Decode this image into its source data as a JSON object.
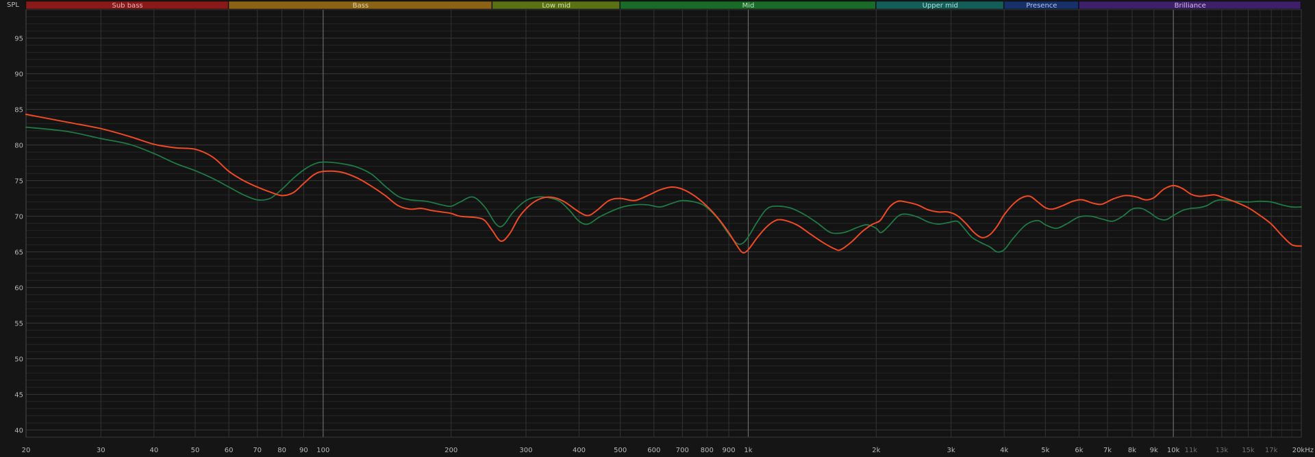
{
  "chart_data": {
    "type": "line",
    "y_axis_label": "SPL",
    "x_scale": "log",
    "y_scale": "linear",
    "xlim": [
      20,
      20000
    ],
    "ylim": [
      39,
      99
    ],
    "y_ticks": [
      {
        "value": 40,
        "label": "40"
      },
      {
        "value": 45,
        "label": "45"
      },
      {
        "value": 50,
        "label": "50"
      },
      {
        "value": 55,
        "label": "55"
      },
      {
        "value": 60,
        "label": "60"
      },
      {
        "value": 65,
        "label": "65"
      },
      {
        "value": 70,
        "label": "70"
      },
      {
        "value": 75,
        "label": "75"
      },
      {
        "value": 80,
        "label": "80"
      },
      {
        "value": 85,
        "label": "85"
      },
      {
        "value": 90,
        "label": "90"
      },
      {
        "value": 95,
        "label": "95"
      }
    ],
    "x_ticks": [
      {
        "value": 20,
        "label": "20",
        "major": true
      },
      {
        "value": 30,
        "label": "30"
      },
      {
        "value": 40,
        "label": "40"
      },
      {
        "value": 50,
        "label": "50"
      },
      {
        "value": 60,
        "label": "60"
      },
      {
        "value": 70,
        "label": "70"
      },
      {
        "value": 80,
        "label": "80"
      },
      {
        "value": 90,
        "label": "90"
      },
      {
        "value": 100,
        "label": "100",
        "major": true
      },
      {
        "value": 200,
        "label": "200"
      },
      {
        "value": 300,
        "label": "300"
      },
      {
        "value": 400,
        "label": "400"
      },
      {
        "value": 500,
        "label": "500"
      },
      {
        "value": 600,
        "label": "600"
      },
      {
        "value": 700,
        "label": "700"
      },
      {
        "value": 800,
        "label": "800"
      },
      {
        "value": 900,
        "label": "900"
      },
      {
        "value": 1000,
        "label": "1k",
        "major": true
      },
      {
        "value": 2000,
        "label": "2k"
      },
      {
        "value": 3000,
        "label": "3k"
      },
      {
        "value": 4000,
        "label": "4k"
      },
      {
        "value": 5000,
        "label": "5k"
      },
      {
        "value": 6000,
        "label": "6k"
      },
      {
        "value": 7000,
        "label": "7k"
      },
      {
        "value": 8000,
        "label": "8k"
      },
      {
        "value": 9000,
        "label": "9k"
      },
      {
        "value": 10000,
        "label": "10k",
        "major": true
      },
      {
        "value": 11000,
        "label": "11k",
        "dim": true
      },
      {
        "value": 13000,
        "label": "13k",
        "dim": true
      },
      {
        "value": 15000,
        "label": "15k",
        "dim": true
      },
      {
        "value": 17000,
        "label": "17k",
        "dim": true
      },
      {
        "value": 20000,
        "label": "20kHz"
      }
    ],
    "bands": [
      {
        "name": "Sub bass",
        "from": 20,
        "to": 60,
        "fill": "#8a1a1a",
        "text": "#e8b4b4"
      },
      {
        "name": "Bass",
        "from": 60,
        "to": 250,
        "fill": "#8a6414",
        "text": "#e6d2a6"
      },
      {
        "name": "Low mid",
        "from": 250,
        "to": 500,
        "fill": "#5a7214",
        "text": "#d2e2a6"
      },
      {
        "name": "Mid",
        "from": 500,
        "to": 2000,
        "fill": "#1a6a28",
        "text": "#b8e2bc"
      },
      {
        "name": "Upper mid",
        "from": 2000,
        "to": 4000,
        "fill": "#145e5a",
        "text": "#aee0dc"
      },
      {
        "name": "Presence",
        "from": 4000,
        "to": 6000,
        "fill": "#16306a",
        "text": "#b4c4ea"
      },
      {
        "name": "Brilliance",
        "from": 6000,
        "to": 20000,
        "fill": "#3e1f6a",
        "text": "#d2bcea"
      }
    ],
    "series": [
      {
        "color": "#1f7a45",
        "points": [
          [
            20,
            82.5
          ],
          [
            25,
            81.9
          ],
          [
            30,
            80.9
          ],
          [
            35,
            80.1
          ],
          [
            40,
            78.8
          ],
          [
            45,
            77.4
          ],
          [
            50,
            76.4
          ],
          [
            55,
            75.3
          ],
          [
            60,
            74.1
          ],
          [
            65,
            73.0
          ],
          [
            70,
            72.3
          ],
          [
            75,
            72.5
          ],
          [
            80,
            73.8
          ],
          [
            85,
            75.3
          ],
          [
            90,
            76.5
          ],
          [
            95,
            77.3
          ],
          [
            100,
            77.6
          ],
          [
            110,
            77.4
          ],
          [
            120,
            76.9
          ],
          [
            130,
            75.9
          ],
          [
            140,
            74.2
          ],
          [
            150,
            72.8
          ],
          [
            160,
            72.3
          ],
          [
            175,
            72.1
          ],
          [
            190,
            71.6
          ],
          [
            200,
            71.4
          ],
          [
            210,
            72.0
          ],
          [
            225,
            72.7
          ],
          [
            240,
            71.3
          ],
          [
            255,
            68.9
          ],
          [
            265,
            68.7
          ],
          [
            280,
            70.6
          ],
          [
            300,
            72.2
          ],
          [
            320,
            72.7
          ],
          [
            340,
            72.6
          ],
          [
            360,
            72.1
          ],
          [
            380,
            70.8
          ],
          [
            400,
            69.3
          ],
          [
            420,
            68.9
          ],
          [
            450,
            70.0
          ],
          [
            500,
            71.2
          ],
          [
            540,
            71.6
          ],
          [
            580,
            71.6
          ],
          [
            620,
            71.3
          ],
          [
            660,
            71.8
          ],
          [
            700,
            72.2
          ],
          [
            760,
            71.9
          ],
          [
            800,
            71.2
          ],
          [
            850,
            69.6
          ],
          [
            900,
            67.5
          ],
          [
            940,
            66.2
          ],
          [
            970,
            66.2
          ],
          [
            1000,
            67.1
          ],
          [
            1050,
            69.2
          ],
          [
            1100,
            70.9
          ],
          [
            1150,
            71.4
          ],
          [
            1250,
            71.2
          ],
          [
            1350,
            70.3
          ],
          [
            1450,
            69.1
          ],
          [
            1550,
            67.8
          ],
          [
            1620,
            67.6
          ],
          [
            1700,
            67.8
          ],
          [
            1800,
            68.4
          ],
          [
            1900,
            68.8
          ],
          [
            2000,
            68.3
          ],
          [
            2050,
            67.7
          ],
          [
            2130,
            68.5
          ],
          [
            2250,
            70.0
          ],
          [
            2350,
            70.3
          ],
          [
            2500,
            69.9
          ],
          [
            2650,
            69.2
          ],
          [
            2800,
            68.9
          ],
          [
            2950,
            69.1
          ],
          [
            3100,
            69.3
          ],
          [
            3200,
            68.5
          ],
          [
            3350,
            67.1
          ],
          [
            3500,
            66.4
          ],
          [
            3700,
            65.7
          ],
          [
            3850,
            65.0
          ],
          [
            4000,
            65.3
          ],
          [
            4200,
            66.9
          ],
          [
            4500,
            68.8
          ],
          [
            4800,
            69.4
          ],
          [
            5000,
            68.8
          ],
          [
            5300,
            68.3
          ],
          [
            5600,
            68.9
          ],
          [
            6000,
            69.9
          ],
          [
            6400,
            70.0
          ],
          [
            6800,
            69.6
          ],
          [
            7200,
            69.3
          ],
          [
            7600,
            70.0
          ],
          [
            8000,
            71.0
          ],
          [
            8400,
            71.1
          ],
          [
            8800,
            70.5
          ],
          [
            9200,
            69.7
          ],
          [
            9600,
            69.5
          ],
          [
            10000,
            70.1
          ],
          [
            10500,
            70.8
          ],
          [
            11000,
            71.1
          ],
          [
            11500,
            71.2
          ],
          [
            12000,
            71.5
          ],
          [
            12500,
            72.1
          ],
          [
            13000,
            72.3
          ],
          [
            14000,
            72.1
          ],
          [
            15000,
            72.0
          ],
          [
            16000,
            72.1
          ],
          [
            17000,
            72.0
          ],
          [
            18000,
            71.6
          ],
          [
            19000,
            71.3
          ],
          [
            20000,
            71.3
          ]
        ]
      },
      {
        "color": "#f04a24",
        "points": [
          [
            20,
            84.3
          ],
          [
            25,
            83.2
          ],
          [
            30,
            82.3
          ],
          [
            35,
            81.2
          ],
          [
            40,
            80.1
          ],
          [
            45,
            79.6
          ],
          [
            50,
            79.4
          ],
          [
            55,
            78.3
          ],
          [
            60,
            76.3
          ],
          [
            65,
            75.0
          ],
          [
            70,
            74.1
          ],
          [
            75,
            73.4
          ],
          [
            80,
            72.9
          ],
          [
            85,
            73.3
          ],
          [
            90,
            74.6
          ],
          [
            95,
            75.8
          ],
          [
            100,
            76.3
          ],
          [
            110,
            76.2
          ],
          [
            120,
            75.4
          ],
          [
            130,
            74.2
          ],
          [
            140,
            72.9
          ],
          [
            150,
            71.5
          ],
          [
            160,
            71.0
          ],
          [
            170,
            71.1
          ],
          [
            180,
            70.8
          ],
          [
            190,
            70.6
          ],
          [
            200,
            70.4
          ],
          [
            210,
            70.0
          ],
          [
            230,
            69.8
          ],
          [
            240,
            69.4
          ],
          [
            250,
            68.0
          ],
          [
            262,
            66.5
          ],
          [
            275,
            67.6
          ],
          [
            290,
            70.0
          ],
          [
            310,
            71.8
          ],
          [
            330,
            72.6
          ],
          [
            350,
            72.6
          ],
          [
            370,
            72.0
          ],
          [
            400,
            70.6
          ],
          [
            420,
            70.1
          ],
          [
            440,
            70.8
          ],
          [
            470,
            72.2
          ],
          [
            500,
            72.5
          ],
          [
            540,
            72.2
          ],
          [
            580,
            72.9
          ],
          [
            620,
            73.7
          ],
          [
            660,
            74.1
          ],
          [
            700,
            73.8
          ],
          [
            750,
            72.8
          ],
          [
            800,
            71.4
          ],
          [
            850,
            69.7
          ],
          [
            900,
            67.7
          ],
          [
            940,
            65.9
          ],
          [
            970,
            64.9
          ],
          [
            1000,
            65.3
          ],
          [
            1050,
            67.0
          ],
          [
            1100,
            68.4
          ],
          [
            1150,
            69.3
          ],
          [
            1200,
            69.5
          ],
          [
            1300,
            68.8
          ],
          [
            1400,
            67.5
          ],
          [
            1500,
            66.3
          ],
          [
            1600,
            65.4
          ],
          [
            1650,
            65.3
          ],
          [
            1750,
            66.4
          ],
          [
            1850,
            67.8
          ],
          [
            1950,
            68.8
          ],
          [
            2000,
            69.1
          ],
          [
            2050,
            69.5
          ],
          [
            2150,
            71.3
          ],
          [
            2250,
            72.1
          ],
          [
            2350,
            72.0
          ],
          [
            2500,
            71.6
          ],
          [
            2650,
            70.9
          ],
          [
            2800,
            70.6
          ],
          [
            2950,
            70.6
          ],
          [
            3100,
            70.1
          ],
          [
            3250,
            69.0
          ],
          [
            3400,
            67.7
          ],
          [
            3550,
            67.0
          ],
          [
            3700,
            67.4
          ],
          [
            3850,
            68.6
          ],
          [
            4000,
            70.2
          ],
          [
            4200,
            71.7
          ],
          [
            4400,
            72.6
          ],
          [
            4600,
            72.8
          ],
          [
            4800,
            72.0
          ],
          [
            5000,
            71.2
          ],
          [
            5200,
            71.0
          ],
          [
            5500,
            71.5
          ],
          [
            5800,
            72.1
          ],
          [
            6100,
            72.3
          ],
          [
            6500,
            71.8
          ],
          [
            6800,
            71.7
          ],
          [
            7200,
            72.4
          ],
          [
            7700,
            72.9
          ],
          [
            8200,
            72.7
          ],
          [
            8600,
            72.3
          ],
          [
            9000,
            72.6
          ],
          [
            9500,
            73.8
          ],
          [
            10000,
            74.3
          ],
          [
            10500,
            73.9
          ],
          [
            11000,
            73.1
          ],
          [
            11500,
            72.8
          ],
          [
            12000,
            72.9
          ],
          [
            12500,
            73.0
          ],
          [
            13000,
            72.7
          ],
          [
            14000,
            72.0
          ],
          [
            15000,
            71.2
          ],
          [
            16000,
            70.1
          ],
          [
            17000,
            68.9
          ],
          [
            18000,
            67.3
          ],
          [
            19000,
            66.0
          ],
          [
            20000,
            65.8
          ]
        ]
      }
    ]
  }
}
